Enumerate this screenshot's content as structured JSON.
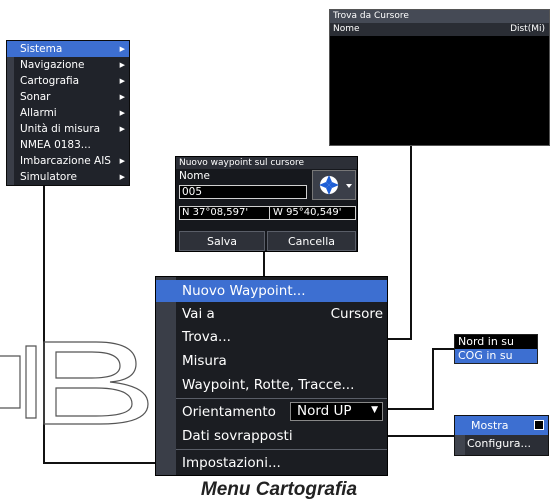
{
  "settings_menu": {
    "items": [
      {
        "label": "Sistema",
        "has_submenu": true,
        "selected": true
      },
      {
        "label": "Navigazione",
        "has_submenu": true
      },
      {
        "label": "Cartografia",
        "has_submenu": true
      },
      {
        "label": "Sonar",
        "has_submenu": true
      },
      {
        "label": "Allarmi",
        "has_submenu": true
      },
      {
        "label": "Unità di misura",
        "has_submenu": true
      },
      {
        "label": "NMEA 0183...",
        "has_submenu": false
      },
      {
        "label": "Imbarcazione AIS",
        "has_submenu": true
      },
      {
        "label": "Simulatore",
        "has_submenu": true
      }
    ]
  },
  "find_window": {
    "title": "Trova da Cursore",
    "col_name": "Nome",
    "col_dist": "Dist(Mi)"
  },
  "new_waypoint_dialog": {
    "title": "Nuovo waypoint sul cursore",
    "name_label": "Nome",
    "name_value": "005",
    "icon": "waypoint-symbol-icon",
    "lat": "N  37°08,597'",
    "lon": "W  95°40,549'",
    "save_label": "Salva",
    "cancel_label": "Cancella"
  },
  "chart_menu": {
    "items": {
      "new_waypoint": "Nuovo Waypoint...",
      "goto": "Vai a",
      "goto_value": "Cursore",
      "find": "Trova...",
      "measure": "Misura",
      "waypoints_routes_trails": "Waypoint, Rotte, Tracce...",
      "orientation": "Orientamento",
      "orientation_value": "Nord UP",
      "overlay_data": "Dati sovrapposti",
      "settings": "Impostazioni..."
    }
  },
  "orientation_options": {
    "items": [
      {
        "label": "Nord in su",
        "selected": false
      },
      {
        "label": "COG in su",
        "selected": true
      }
    ]
  },
  "overlay_popup": {
    "show_label": "Mostra",
    "show_checked": false,
    "configure_label": "Configura..."
  },
  "caption": "Menu Cartografia",
  "colors": {
    "highlight": "#3d6fd1",
    "menu_bg": "#1b1d22",
    "gutter": "#3a3e48"
  }
}
